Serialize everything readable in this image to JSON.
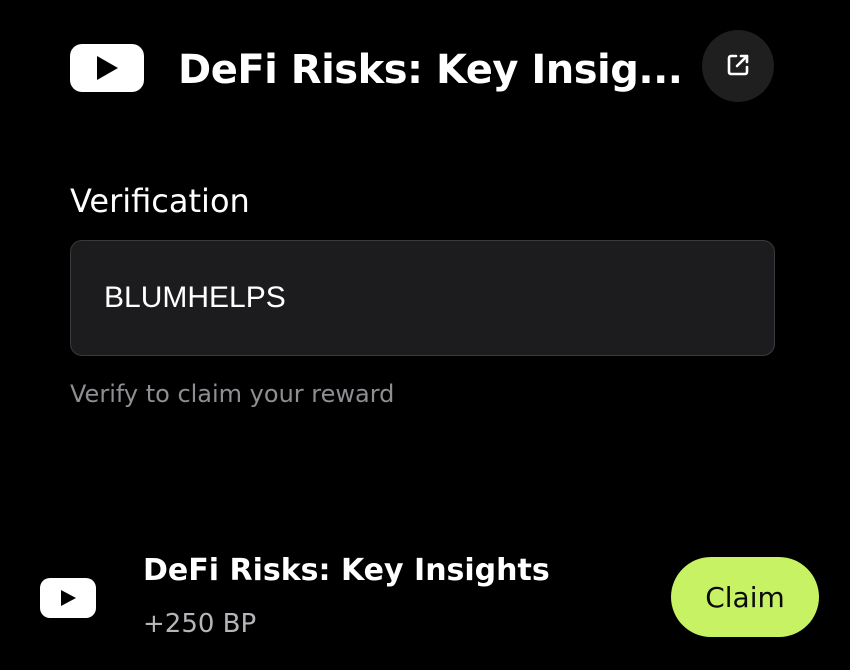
{
  "header": {
    "title": "DeFi Risks: Key Insig...",
    "logo_icon": "youtube-logo-icon",
    "open_icon": "external-link-icon"
  },
  "verification": {
    "label": "Verification",
    "input_value": "BLUMHELPS",
    "hint": "Verify to claim your reward"
  },
  "task": {
    "icon": "youtube-logo-icon",
    "title": "DeFi Risks: Key Insights",
    "reward": "+250 BP",
    "claim_label": "Claim"
  },
  "colors": {
    "background": "#000000",
    "input_background": "#1c1c1e",
    "claim_accent": "#c7f264",
    "muted_text": "#8e8e93"
  }
}
